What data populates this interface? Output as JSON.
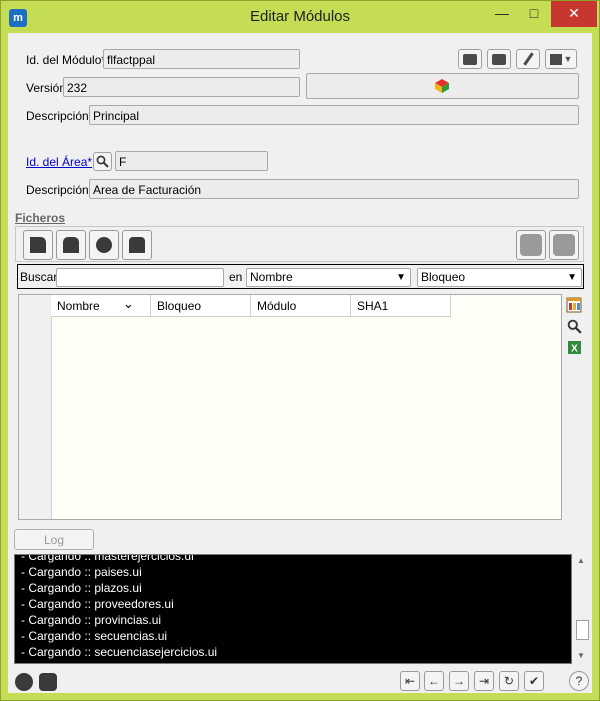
{
  "window": {
    "title": "Editar Módulos",
    "app_icon_label": "m",
    "minimize_glyph": "—",
    "maximize_glyph": "□",
    "close_glyph": "✕"
  },
  "module": {
    "id_label": "Id. del Módulo*",
    "id_value": "flfactppal",
    "version_label": "Versión",
    "version_value": "232",
    "description_label": "Descripción*",
    "description_value": "Principal"
  },
  "area": {
    "id_label": "Id. del Área*",
    "id_value": "F",
    "description_label": "Descripción*",
    "description_value": "Area de Facturación"
  },
  "files": {
    "section_title": "Ficheros",
    "search_label": "Buscar",
    "search_value": "",
    "in_label": "en",
    "search_field_selected": "Nombre",
    "filter_selected": "Bloqueo",
    "columns": [
      "Nombre",
      "Bloqueo",
      "Módulo",
      "SHA1"
    ],
    "sort_indicator": "⌄"
  },
  "log": {
    "button_label": "Log",
    "lines": [
      "- Cargando :: masterejercicios.ui",
      "- Cargando :: paises.ui",
      "- Cargando :: plazos.ui",
      "- Cargando :: proveedores.ui",
      "- Cargando :: provincias.ui",
      "- Cargando :: secuencias.ui",
      "- Cargando :: secuenciasejercicios.ui"
    ]
  },
  "nav": {
    "first_glyph": "⇤",
    "prev_glyph": "←",
    "next_glyph": "→",
    "last_glyph": "⇥",
    "refresh_glyph": "↻",
    "accept_glyph": "✔",
    "help_glyph": "?"
  },
  "colors": {
    "title_bar": "#c5dc55",
    "close_button": "#c7372f",
    "link": "#0000cc",
    "console_bg": "#000000",
    "console_text": "#ffffff"
  }
}
